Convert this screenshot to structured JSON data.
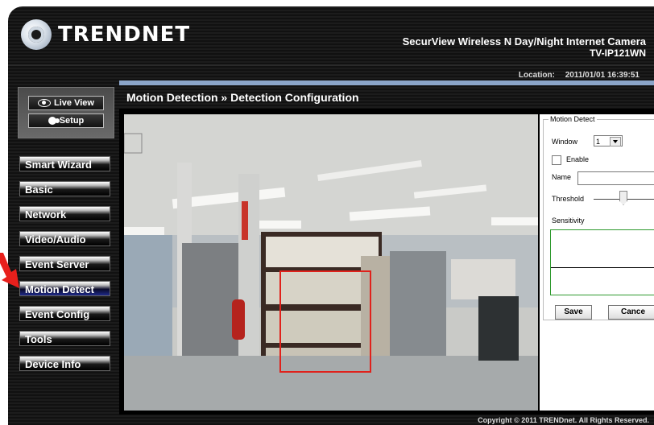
{
  "header": {
    "brand": "TRENDNET",
    "product_line1": "SecurView Wireless N Day/Night Internet Camera",
    "product_line2": "TV-IP121WN",
    "location_label": "Location:",
    "location_value": "2011/01/01 16:39:51"
  },
  "mode": {
    "live_view": "Live View",
    "setup": "Setup"
  },
  "nav": {
    "items": [
      {
        "label": "Smart Wizard"
      },
      {
        "label": "Basic"
      },
      {
        "label": "Network"
      },
      {
        "label": "Video/Audio"
      },
      {
        "label": "Event Server"
      },
      {
        "label": "Motion Detect"
      },
      {
        "label": "Event Config"
      },
      {
        "label": "Tools"
      },
      {
        "label": "Device Info"
      }
    ],
    "active_index": 5
  },
  "panel": {
    "title": "Motion Detection » Detection Configuration"
  },
  "settings": {
    "group_legend": "Motion Detect",
    "window_label": "Window",
    "window_value": "1",
    "enable_label": "Enable",
    "name_label": "Name",
    "name_value": "",
    "threshold_label": "Threshold",
    "sensitivity_label": "Sensitivity",
    "save_label": "Save",
    "cancel_label": "Cance"
  },
  "footer": {
    "copyright": "Copyright © 2011 TRENDnet. All Rights Reserved."
  },
  "colors": {
    "accent_bar": "#8aa4c8",
    "motion_box": "#e0211b",
    "active_nav": "#1f2a8a",
    "arrow": "#e8201c"
  }
}
